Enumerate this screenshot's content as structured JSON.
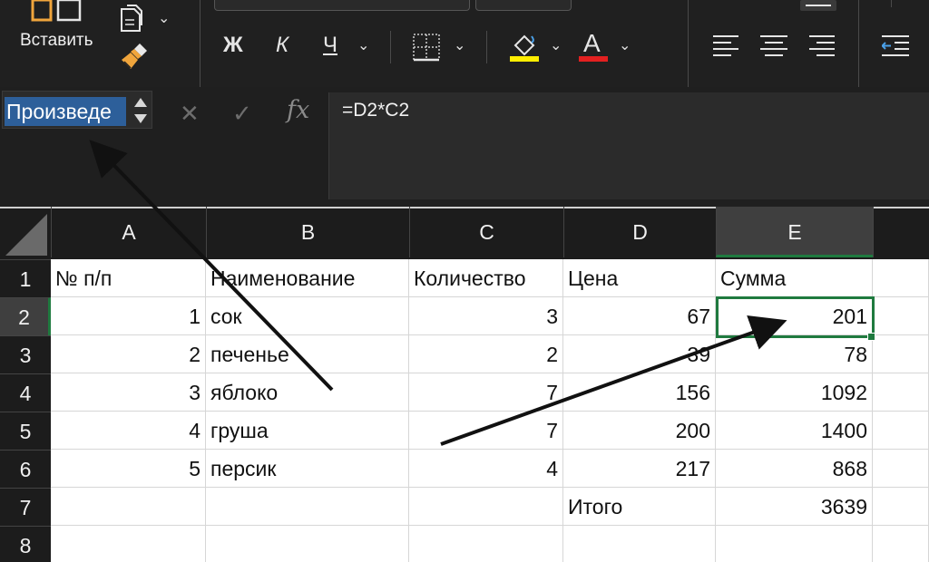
{
  "ribbon": {
    "paste_label": "Вставить",
    "icons": [
      "paste-icon",
      "copy-icon",
      "format-painter-icon",
      "bold-icon",
      "italic-icon",
      "underline-icon",
      "borders-icon",
      "fill-color-icon",
      "font-color-icon",
      "align-left-icon",
      "align-center-icon",
      "align-right-icon",
      "decrease-indent-icon"
    ],
    "bold_label": "Ж",
    "italic_label": "К",
    "underline_label": "Ч",
    "fill_color": "#ffee00",
    "font_color": "#e32020"
  },
  "formula_bar": {
    "name_box": "Произведе",
    "fx_label": "fx",
    "formula": "=D2*C2"
  },
  "sheet": {
    "columns": [
      "A",
      "B",
      "C",
      "D",
      "E"
    ],
    "selected_column": "E",
    "rows": [
      "1",
      "2",
      "3",
      "4",
      "5",
      "6",
      "7",
      "8"
    ],
    "selected_row": "2",
    "cells": [
      [
        "№ п/п",
        "Наименование",
        "Количество",
        "Цена",
        "Сумма"
      ],
      [
        "1",
        "сок",
        "3",
        "67",
        "201"
      ],
      [
        "2",
        "печенье",
        "2",
        "39",
        "78"
      ],
      [
        "3",
        "яблоко",
        "7",
        "156",
        "1092"
      ],
      [
        "4",
        "груша",
        "7",
        "200",
        "1400"
      ],
      [
        "5",
        "персик",
        "4",
        "217",
        "868"
      ],
      [
        "",
        "",
        "",
        "Итого",
        "3639"
      ],
      [
        "",
        "",
        "",
        "",
        ""
      ]
    ],
    "active_cell": "E2",
    "accent_color": "#1f7a3f"
  }
}
